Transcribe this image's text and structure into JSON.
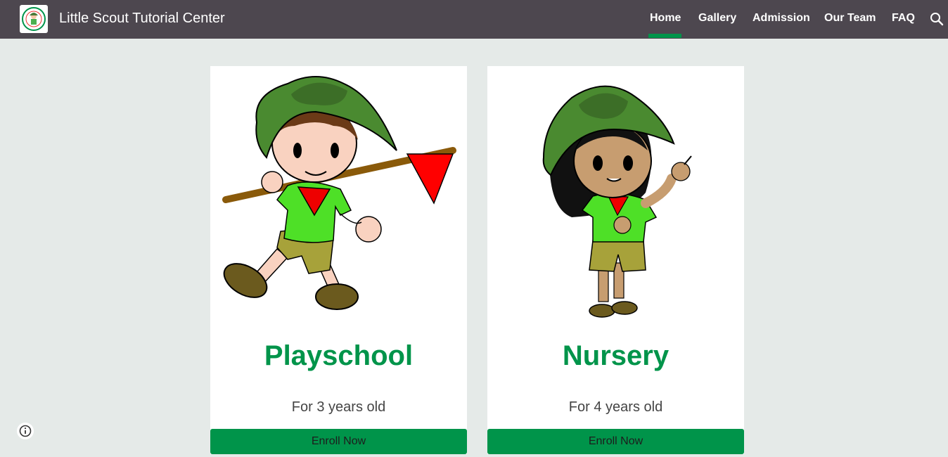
{
  "header": {
    "logo_icon": "little-scouts-logo-icon",
    "site_title": "Little Scout Tutorial Center",
    "nav": [
      {
        "label": "Home",
        "active": true
      },
      {
        "label": "Gallery",
        "active": false
      },
      {
        "label": "Admission",
        "active": false
      },
      {
        "label": "Our Team",
        "active": false
      },
      {
        "label": "FAQ",
        "active": false
      }
    ],
    "search_icon": "search-icon",
    "bg_color": "#4d474f",
    "accent_color": "#00944a"
  },
  "cards": [
    {
      "title": "Playschool",
      "subtitle": "For 3 years old",
      "button": "Enroll Now",
      "image_icon": "boy-scout-illustration"
    },
    {
      "title": "Nursery",
      "subtitle": "For 4 years old",
      "button": "Enroll Now",
      "image_icon": "girl-scout-illustration"
    }
  ],
  "footer": {
    "info_icon": "info-icon"
  }
}
